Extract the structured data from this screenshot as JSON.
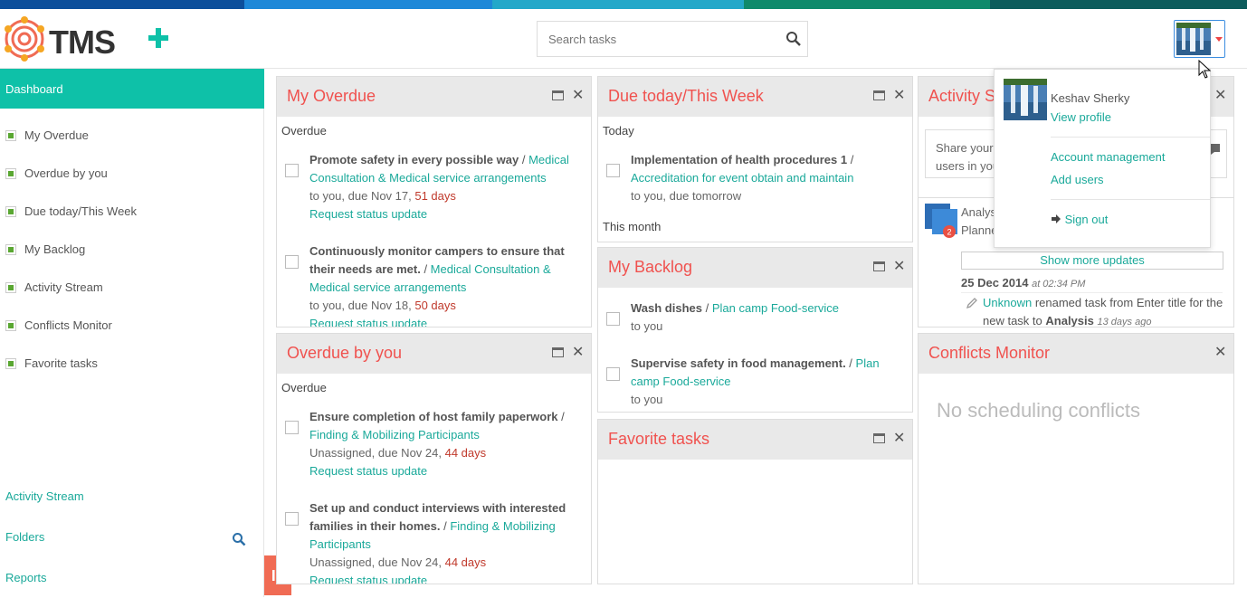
{
  "colors": {
    "accent": "#0ec1a8",
    "widget_title": "#f0524f",
    "link": "#1aa99a",
    "due_red": "#c0392b",
    "stripe": [
      "#0d4f9b",
      "#1e88d8",
      "#23a8c9",
      "#0f8a6b",
      "#0d5c5c"
    ]
  },
  "header": {
    "logo_text": "TMS",
    "search_placeholder": "Search tasks"
  },
  "sidebar": {
    "dashboard_label": "Dashboard",
    "items": [
      {
        "label": "My Overdue"
      },
      {
        "label": "Overdue by you"
      },
      {
        "label": "Due today/This Week"
      },
      {
        "label": "My Backlog"
      },
      {
        "label": "Activity Stream"
      },
      {
        "label": "Conflicts Monitor"
      },
      {
        "label": "Favorite tasks"
      }
    ],
    "links": {
      "activity_stream": "Activity Stream",
      "folders": "Folders",
      "reports": "Reports"
    }
  },
  "my_overdue": {
    "title": "My Overdue",
    "section": "Overdue",
    "tasks": [
      {
        "name": "Promote safety in every possible way",
        "project": "Medical Consultation & Medical service arrangements",
        "assign": "to you, due Nov 17, ",
        "days": "51 days",
        "action": "Request status update"
      },
      {
        "name": "Continuously monitor campers to ensure that their needs are met.",
        "project": "Medical Consultation & Medical service arrangements",
        "assign": "to you, due Nov 18, ",
        "days": "50 days",
        "action": "Request status update"
      }
    ]
  },
  "overdue_by_you": {
    "title": "Overdue by you",
    "section": "Overdue",
    "tasks": [
      {
        "name": "Ensure completion of host family paperwork",
        "project": "Finding & Mobilizing Participants",
        "assign": "Unassigned, due Nov 24, ",
        "days": "44 days",
        "action": "Request status update"
      },
      {
        "name": "Set up and conduct interviews with interested families in their homes.",
        "project": "Finding & Mobilizing Participants",
        "assign": "Unassigned, due Nov 24, ",
        "days": "44 days",
        "action": "Request status update"
      }
    ]
  },
  "due_today": {
    "title": "Due today/This Week",
    "section_today": "Today",
    "section_month": "This month",
    "tasks": [
      {
        "name": "Implementation of health procedures 1",
        "project": "Accreditation for event obtain and maintain",
        "assign": "to you, due tomorrow"
      }
    ]
  },
  "my_backlog": {
    "title": "My Backlog",
    "tasks": [
      {
        "name": "Wash dishes",
        "project": "Plan camp Food-service",
        "assign": "to you"
      },
      {
        "name": "Supervise safety in food management.",
        "project": "Plan camp Food-service",
        "assign": "to you"
      }
    ]
  },
  "favorite_tasks": {
    "title": "Favorite tasks"
  },
  "activity_stream": {
    "title": "Activity S",
    "share_line1": "Share your",
    "share_line2": "users in you",
    "update_name": "Analys",
    "update_sub": "Planne",
    "badge": "2",
    "show_more": "Show more updates",
    "date": "25 Dec 2014",
    "time": "at 02:34 PM",
    "user": "Unknown",
    "action": "renamed task from Enter title for the new task to",
    "target": "Analysis",
    "ago": "13 days ago"
  },
  "conflicts": {
    "title": "Conflicts Monitor",
    "empty": "No scheduling conflicts"
  },
  "user_menu": {
    "name": "Keshav Sherky",
    "view_profile": "View profile",
    "account": "Account management",
    "add_users": "Add users",
    "sign_out": "Sign out"
  }
}
